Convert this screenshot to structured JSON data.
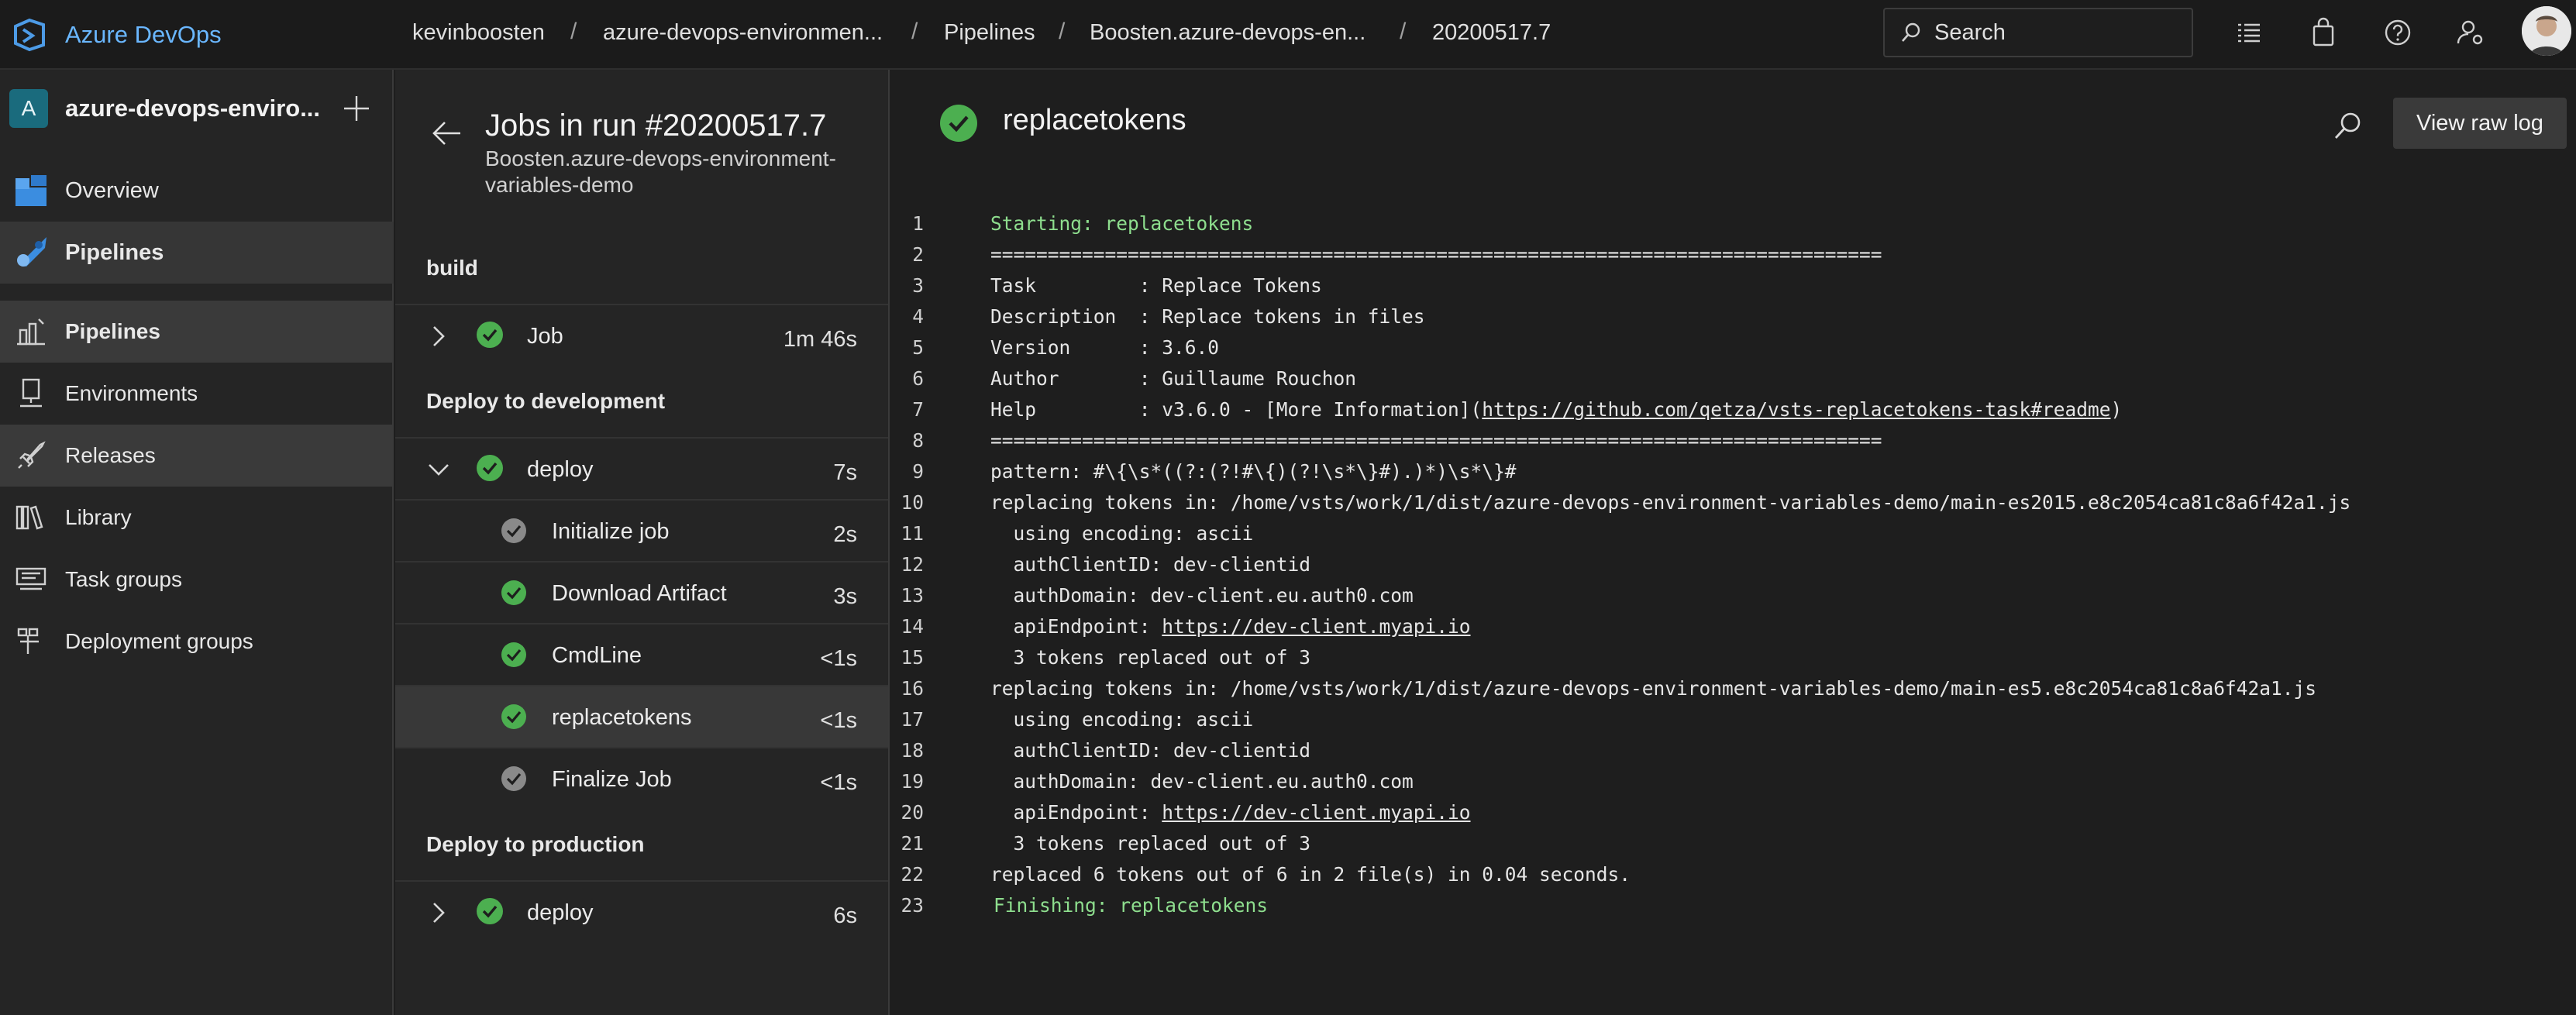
{
  "topbar": {
    "brand": "Azure DevOps",
    "breadcrumbs": [
      "kevinboosten",
      "azure-devops-environmen...",
      "Pipelines",
      "Boosten.azure-devops-en...",
      "20200517.7"
    ],
    "separator": "/",
    "search_placeholder": "Search"
  },
  "sidebar": {
    "project_initial": "A",
    "project_name": "azure-devops-enviro...",
    "items": [
      {
        "label": "Overview"
      },
      {
        "label": "Pipelines"
      },
      {
        "label": "Pipelines"
      },
      {
        "label": "Environments"
      },
      {
        "label": "Releases"
      },
      {
        "label": "Library"
      },
      {
        "label": "Task groups"
      },
      {
        "label": "Deployment groups"
      }
    ]
  },
  "jobs": {
    "title": "Jobs in run #20200517.7",
    "subtitle": "Boosten.azure-devops-environment-variables-demo",
    "stages": [
      {
        "name": "build"
      },
      {
        "name": "Deploy to development"
      },
      {
        "name": "Deploy to production"
      }
    ],
    "rows": [
      {
        "name": "Job",
        "duration": "1m 46s"
      },
      {
        "name": "deploy",
        "duration": "7s"
      },
      {
        "name": "Initialize job",
        "duration": "2s"
      },
      {
        "name": "Download Artifact",
        "duration": "3s"
      },
      {
        "name": "CmdLine",
        "duration": "<1s"
      },
      {
        "name": "replacetokens",
        "duration": "<1s"
      },
      {
        "name": "Finalize Job",
        "duration": "<1s"
      },
      {
        "name": "deploy",
        "duration": "6s"
      }
    ]
  },
  "log": {
    "title": "replacetokens",
    "raw_button": "View raw log",
    "lines": [
      {
        "n": "1",
        "text": "Starting: replacetokens"
      },
      {
        "n": "2",
        "text": "=============================================================================="
      },
      {
        "n": "3",
        "text": "Task         : Replace Tokens"
      },
      {
        "n": "4",
        "text": "Description  : Replace tokens in files"
      },
      {
        "n": "5",
        "text": "Version      : 3.6.0"
      },
      {
        "n": "6",
        "text": "Author       : Guillaume Rouchon"
      },
      {
        "n": "7",
        "text": "Help         : v3.6.0 - [More Information](",
        "link": "https://github.com/qetza/vsts-replacetokens-task#readme",
        "after": ")"
      },
      {
        "n": "8",
        "text": "=============================================================================="
      },
      {
        "n": "9",
        "text": "pattern: #\\{\\s*((?:(?!#\\{)(?!\\s*\\}#).)*)\\s*\\}#"
      },
      {
        "n": "10",
        "text": "replacing tokens in: /home/vsts/work/1/dist/azure-devops-environment-variables-demo/main-es2015.e8c2054ca81c8a6f42a1.js"
      },
      {
        "n": "11",
        "text": "  using encoding: ascii"
      },
      {
        "n": "12",
        "text": "  authClientID: dev-clientid"
      },
      {
        "n": "13",
        "text": "  authDomain: dev-client.eu.auth0.com"
      },
      {
        "n": "14",
        "text": "  apiEndpoint: ",
        "link": "https://dev-client.myapi.io",
        "after": ""
      },
      {
        "n": "15",
        "text": "  3 tokens replaced out of 3"
      },
      {
        "n": "16",
        "text": "replacing tokens in: /home/vsts/work/1/dist/azure-devops-environment-variables-demo/main-es5.e8c2054ca81c8a6f42a1.js"
      },
      {
        "n": "17",
        "text": "  using encoding: ascii"
      },
      {
        "n": "18",
        "text": "  authClientID: dev-clientid"
      },
      {
        "n": "19",
        "text": "  authDomain: dev-client.eu.auth0.com"
      },
      {
        "n": "20",
        "text": "  apiEndpoint: ",
        "link": "https://dev-client.myapi.io",
        "after": ""
      },
      {
        "n": "21",
        "text": "  3 tokens replaced out of 3"
      },
      {
        "n": "22",
        "text": "replaced 6 tokens out of 6 in 2 file(s) in 0.04 seconds."
      },
      {
        "n": "23",
        "text": "Finishing: replacetokens"
      }
    ]
  },
  "colors": {
    "success": "#4caf50",
    "brand": "#6ab7ff",
    "log_green": "#8ede8e"
  },
  "icons": [
    "azure-devops-logo-icon",
    "search-icon",
    "backlog-icon",
    "shopping-bag-icon",
    "help-icon",
    "user-settings-icon",
    "plus-icon",
    "overview-icon",
    "pipelines-icon",
    "environments-icon",
    "releases-icon",
    "library-icon",
    "task-groups-icon",
    "deployment-groups-icon",
    "back-arrow-icon",
    "chevron-right-icon",
    "chevron-down-icon",
    "success-check-icon"
  ]
}
